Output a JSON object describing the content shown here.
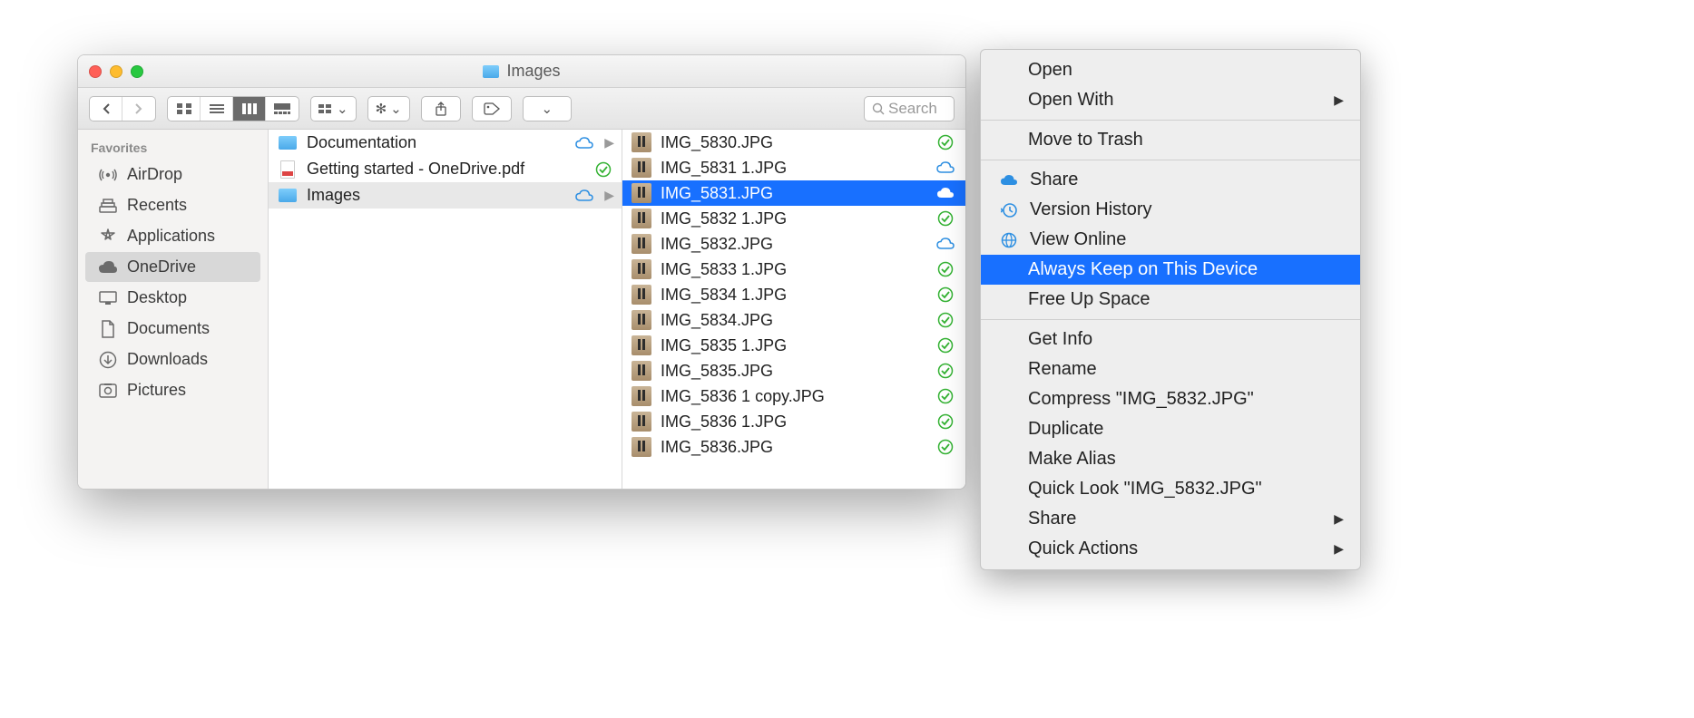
{
  "window": {
    "title": "Images"
  },
  "search": {
    "placeholder": "Search"
  },
  "sidebar": {
    "header": "Favorites",
    "items": [
      {
        "label": "AirDrop",
        "icon": "airdrop",
        "selected": false
      },
      {
        "label": "Recents",
        "icon": "recents",
        "selected": false
      },
      {
        "label": "Applications",
        "icon": "applications",
        "selected": false
      },
      {
        "label": "OneDrive",
        "icon": "cloud",
        "selected": true
      },
      {
        "label": "Desktop",
        "icon": "desktop",
        "selected": false
      },
      {
        "label": "Documents",
        "icon": "document",
        "selected": false
      },
      {
        "label": "Downloads",
        "icon": "downloads",
        "selected": false
      },
      {
        "label": "Pictures",
        "icon": "pictures",
        "selected": false
      }
    ]
  },
  "column1": [
    {
      "label": "Documentation",
      "type": "folder",
      "status": "cloud",
      "chev": true
    },
    {
      "label": "Getting started - OneDrive.pdf",
      "type": "pdf",
      "status": "synced",
      "chev": false
    },
    {
      "label": "Images",
      "type": "folder",
      "status": "cloud",
      "chev": true,
      "selected": true
    }
  ],
  "column2": [
    {
      "label": "IMG_5830.JPG",
      "status": "synced"
    },
    {
      "label": "IMG_5831 1.JPG",
      "status": "cloud"
    },
    {
      "label": "IMG_5831.JPG",
      "status": "cloud-white",
      "selected": true
    },
    {
      "label": "IMG_5832 1.JPG",
      "status": "synced"
    },
    {
      "label": "IMG_5832.JPG",
      "status": "cloud"
    },
    {
      "label": "IMG_5833 1.JPG",
      "status": "synced"
    },
    {
      "label": "IMG_5834 1.JPG",
      "status": "synced"
    },
    {
      "label": "IMG_5834.JPG",
      "status": "synced"
    },
    {
      "label": "IMG_5835 1.JPG",
      "status": "synced"
    },
    {
      "label": "IMG_5835.JPG",
      "status": "synced"
    },
    {
      "label": "IMG_5836 1 copy.JPG",
      "status": "synced"
    },
    {
      "label": "IMG_5836 1.JPG",
      "status": "synced"
    },
    {
      "label": "IMG_5836.JPG",
      "status": "synced"
    }
  ],
  "contextMenu": {
    "groups": [
      [
        {
          "label": "Open"
        },
        {
          "label": "Open With",
          "submenu": true
        }
      ],
      [
        {
          "label": "Move to Trash"
        }
      ],
      [
        {
          "label": "Share",
          "icon": "cloud-filled"
        },
        {
          "label": "Version History",
          "icon": "history"
        },
        {
          "label": "View Online",
          "icon": "globe"
        },
        {
          "label": "Always Keep on This Device",
          "highlight": true,
          "indent": true
        },
        {
          "label": "Free Up Space",
          "indent": true
        }
      ],
      [
        {
          "label": "Get Info"
        },
        {
          "label": "Rename"
        },
        {
          "label": "Compress \"IMG_5832.JPG\""
        },
        {
          "label": "Duplicate"
        },
        {
          "label": "Make Alias"
        },
        {
          "label": "Quick Look \"IMG_5832.JPG\""
        },
        {
          "label": "Share",
          "submenu": true
        },
        {
          "label": "Quick Actions",
          "submenu": true
        }
      ]
    ]
  }
}
